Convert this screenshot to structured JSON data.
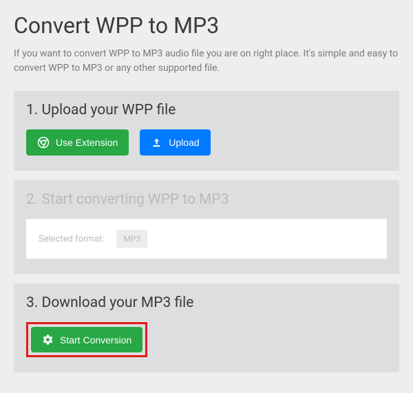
{
  "page": {
    "title": "Convert WPP to MP3",
    "description": "If you want to convert WPP to MP3 audio file you are on right place. It's simple and easy to convert WPP to MP3 or any other supported file."
  },
  "steps": {
    "upload": {
      "title": "1. Upload your WPP file",
      "use_extension_label": "Use Extension",
      "upload_label": "Upload"
    },
    "convert": {
      "title": "2. Start converting WPP to MP3",
      "selected_format_label": "Selected format:",
      "selected_format_value": "MP3"
    },
    "download": {
      "title": "3. Download your MP3 file",
      "start_conversion_label": "Start Conversion"
    }
  }
}
